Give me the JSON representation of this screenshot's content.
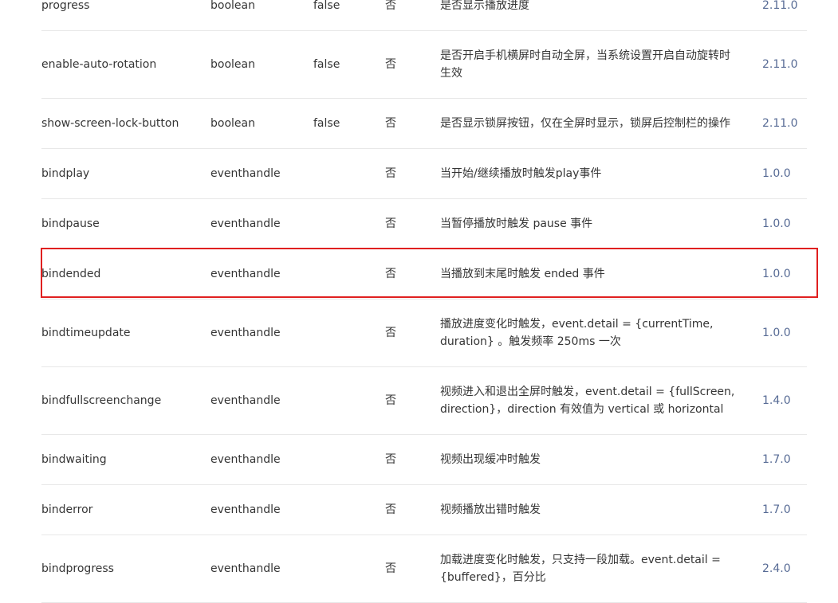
{
  "accent_color": "#576b95",
  "highlight_color": "#e02020",
  "rows": [
    {
      "name": "progress",
      "type": "boolean",
      "default": "false",
      "required": "否",
      "desc": "是否显示播放进度",
      "version": "2.11.0"
    },
    {
      "name": "enable-auto-rotation",
      "type": "boolean",
      "default": "false",
      "required": "否",
      "desc": "是否开启手机横屏时自动全屏，当系统设置开启自动旋转时生效",
      "version": "2.11.0"
    },
    {
      "name": "show-screen-lock-button",
      "type": "boolean",
      "default": "false",
      "required": "否",
      "desc": "是否显示锁屏按钮，仅在全屏时显示，锁屏后控制栏的操作",
      "version": "2.11.0"
    },
    {
      "name": "bindplay",
      "type": "eventhandle",
      "default": "",
      "required": "否",
      "desc": "当开始/继续播放时触发play事件",
      "version": "1.0.0"
    },
    {
      "name": "bindpause",
      "type": "eventhandle",
      "default": "",
      "required": "否",
      "desc": "当暂停播放时触发 pause 事件",
      "version": "1.0.0"
    },
    {
      "name": "bindended",
      "type": "eventhandle",
      "default": "",
      "required": "否",
      "desc": "当播放到末尾时触发 ended 事件",
      "version": "1.0.0"
    },
    {
      "name": "bindtimeupdate",
      "type": "eventhandle",
      "default": "",
      "required": "否",
      "desc": "播放进度变化时触发，event.detail = {currentTime, duration} 。触发频率 250ms 一次",
      "version": "1.0.0"
    },
    {
      "name": "bindfullscreenchange",
      "type": "eventhandle",
      "default": "",
      "required": "否",
      "desc": "视频进入和退出全屏时触发，event.detail = {fullScreen, direction}，direction 有效值为 vertical 或 horizontal",
      "version": "1.4.0"
    },
    {
      "name": "bindwaiting",
      "type": "eventhandle",
      "default": "",
      "required": "否",
      "desc": "视频出现缓冲时触发",
      "version": "1.7.0"
    },
    {
      "name": "binderror",
      "type": "eventhandle",
      "default": "",
      "required": "否",
      "desc": "视频播放出错时触发",
      "version": "1.7.0"
    },
    {
      "name": "bindprogress",
      "type": "eventhandle",
      "default": "",
      "required": "否",
      "desc": "加载进度变化时触发，只支持一段加载。event.detail = {buffered}，百分比",
      "version": "2.4.0"
    }
  ]
}
